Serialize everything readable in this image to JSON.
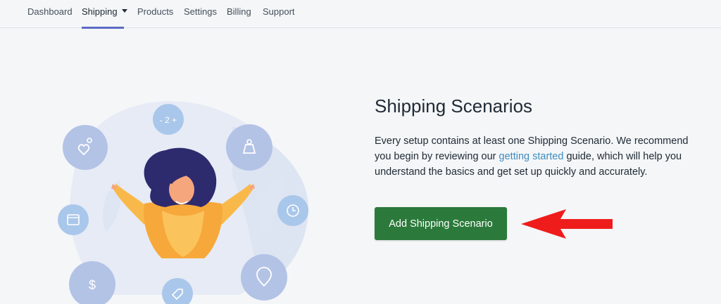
{
  "nav": {
    "items": [
      {
        "label": "Dashboard"
      },
      {
        "label": "Shipping"
      },
      {
        "label": "Products"
      },
      {
        "label": "Settings"
      },
      {
        "label": "Billing"
      },
      {
        "label": "Support"
      }
    ],
    "active": "Shipping"
  },
  "main": {
    "title": "Shipping Scenarios",
    "desc_before": "Every setup contains at least one Shipping Scenario. We recommend you begin by reviewing our ",
    "desc_link": "getting started",
    "desc_after": " guide, which will help you understand the basics and get set up quickly and accurately.",
    "add_button": "Add Shipping Scenario"
  },
  "illustration": {
    "counter_text": "- 2 +",
    "icons": [
      "location-heart-icon",
      "weight-icon",
      "calendar-icon",
      "clock-icon",
      "dollar-icon",
      "map-pin-icon",
      "price-tag-icon",
      "counter-icon"
    ]
  },
  "colors": {
    "accent": "#5c6ac4",
    "button": "#2b7a3b",
    "link": "#3f8bbf",
    "arrow": "#ef1c1c"
  }
}
